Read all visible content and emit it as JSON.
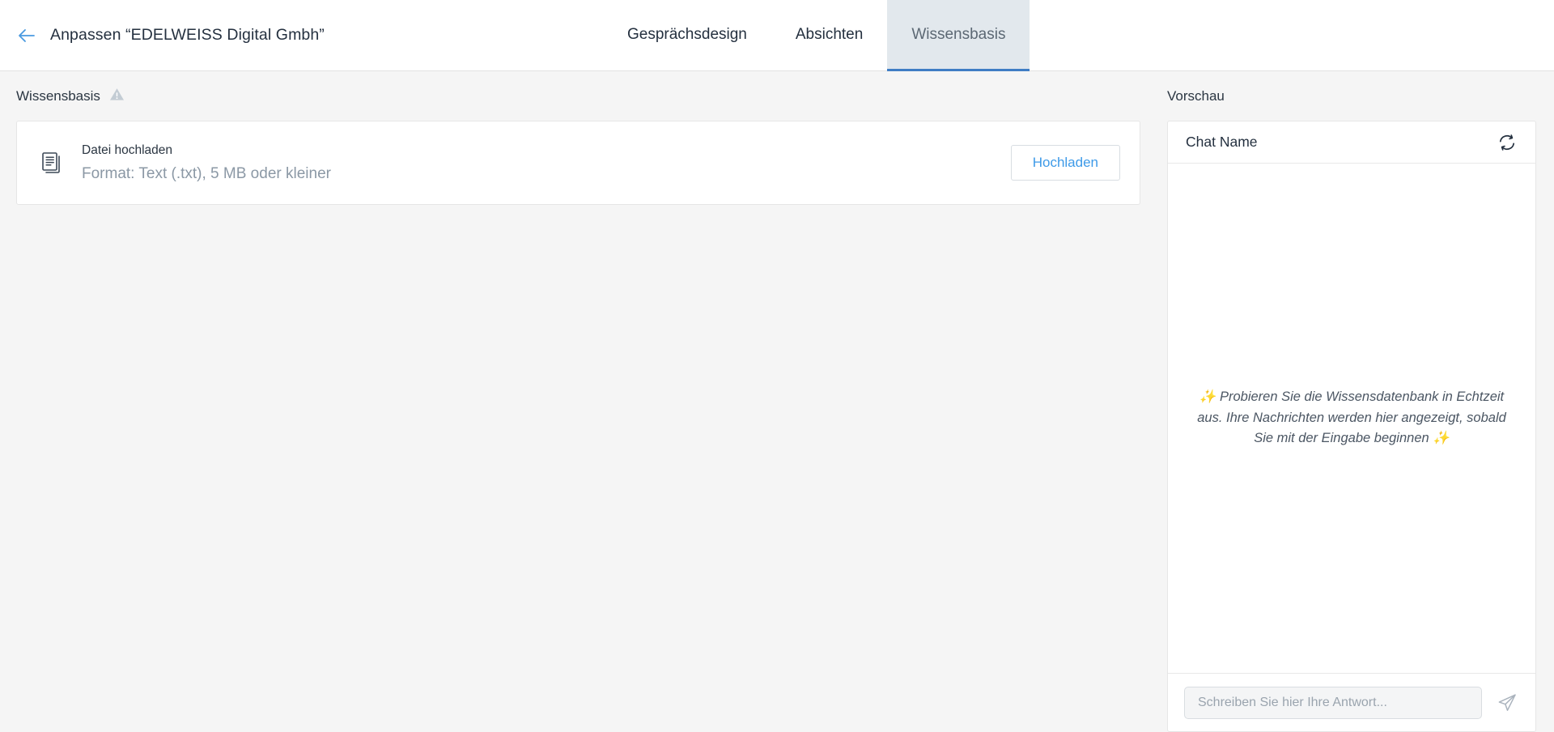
{
  "header": {
    "back_icon": "arrow-left-icon",
    "title": "Anpassen “EDELWEISS Digital Gmbh”",
    "tabs": [
      {
        "label": "Gesprächsdesign",
        "active": false
      },
      {
        "label": "Absichten",
        "active": false
      },
      {
        "label": "Wissensbasis",
        "active": true
      }
    ]
  },
  "knowledge": {
    "section_label": "Wissensbasis",
    "warning_icon": "warning-triangle-icon",
    "upload_card": {
      "file_icon": "document-icon",
      "title": "Datei hochladen",
      "subtitle": "Format: Text (.txt), 5 MB oder kleiner",
      "button_label": "Hochladen"
    }
  },
  "preview": {
    "label": "Vorschau",
    "chat_name": "Chat Name",
    "refresh_icon": "refresh-icon",
    "empty_hint": "✨ Probieren Sie die Wissensdatenbank in Echtzeit aus. Ihre Nachrichten werden hier angezeigt, sobald Sie mit der Eingabe beginnen ✨",
    "input_placeholder": "Schreiben Sie hier Ihre Antwort...",
    "input_value": "",
    "send_icon": "send-paper-plane-icon"
  },
  "colors": {
    "accent_blue": "#3d9ae8",
    "tab_active_bg": "#e2e8ed",
    "tab_active_underline": "#3f7dc4",
    "page_bg": "#f5f5f5",
    "text_dark": "#24303f",
    "text_muted": "#8b98a5"
  }
}
